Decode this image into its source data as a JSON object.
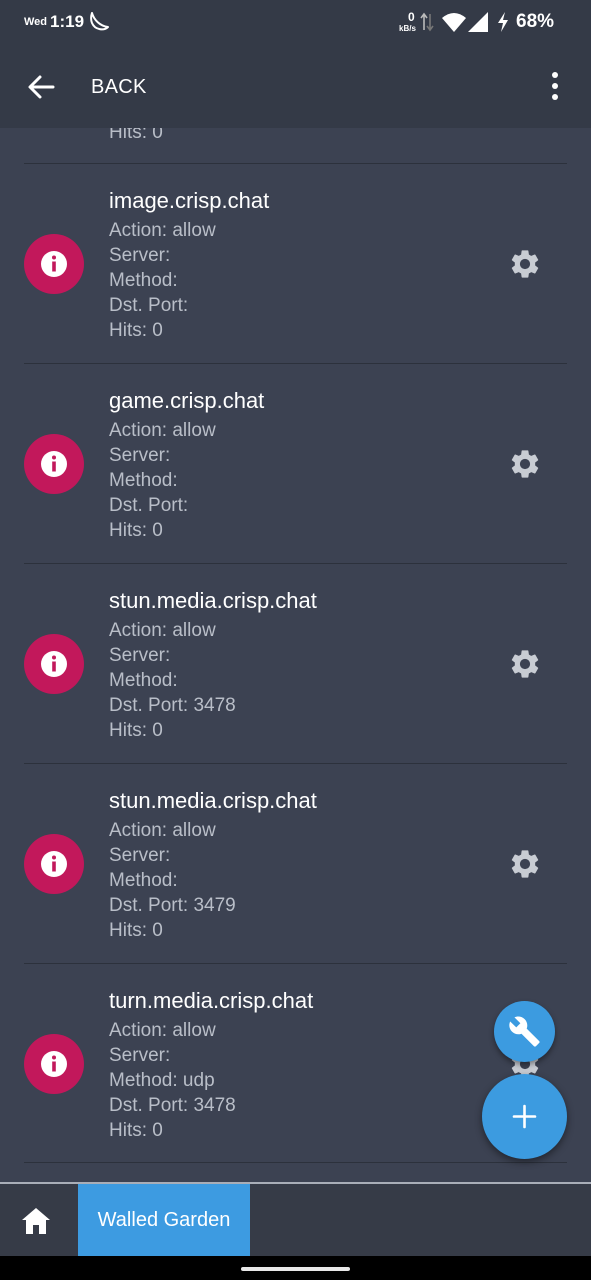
{
  "status_bar": {
    "day": "Wed",
    "time": "1:19",
    "net_speed": "0",
    "net_unit": "kB/s",
    "battery": "68%"
  },
  "app_bar": {
    "back_label": "BACK"
  },
  "list": {
    "partial_hits": "Hits: 0",
    "rules": [
      {
        "domain": "image.crisp.chat",
        "action": "Action: allow",
        "server": "Server:",
        "method": "Method:",
        "port": "Dst. Port:",
        "hits": "Hits: 0"
      },
      {
        "domain": "game.crisp.chat",
        "action": "Action: allow",
        "server": "Server:",
        "method": "Method:",
        "port": "Dst. Port:",
        "hits": "Hits: 0"
      },
      {
        "domain": "stun.media.crisp.chat",
        "action": "Action: allow",
        "server": "Server:",
        "method": "Method:",
        "port": "Dst. Port: 3478",
        "hits": "Hits: 0"
      },
      {
        "domain": "stun.media.crisp.chat",
        "action": "Action: allow",
        "server": "Server:",
        "method": "Method:",
        "port": "Dst. Port: 3479",
        "hits": "Hits: 0"
      },
      {
        "domain": "turn.media.crisp.chat",
        "action": "Action: allow",
        "server": "Server:",
        "method": "Method: udp",
        "port": "Dst. Port: 3478",
        "hits": "Hits: 0"
      }
    ]
  },
  "bottom_nav": {
    "active_tab": "Walled Garden"
  },
  "colors": {
    "accent": "#3d9be1",
    "info_badge": "#c2185b",
    "background": "#3c4252"
  }
}
